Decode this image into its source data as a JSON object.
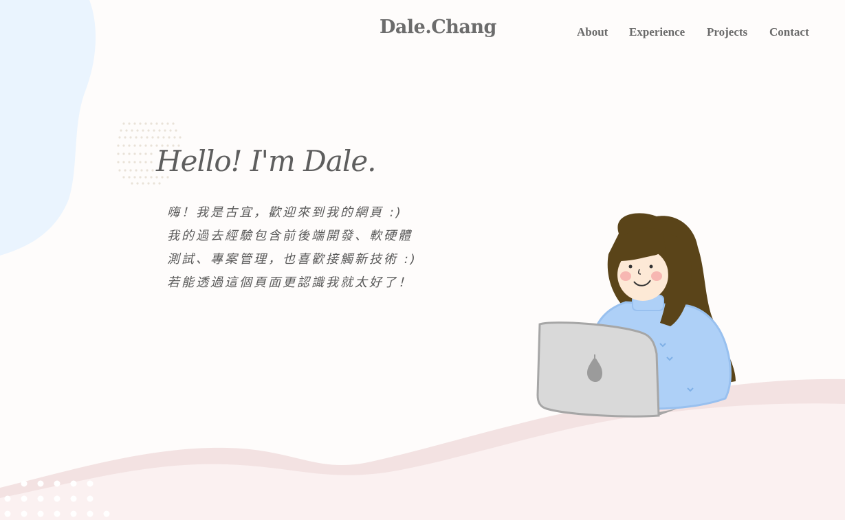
{
  "header": {
    "logo": "Dale.Chang",
    "nav": [
      {
        "label": "About"
      },
      {
        "label": "Experience"
      },
      {
        "label": "Projects"
      },
      {
        "label": "Contact"
      }
    ]
  },
  "hero": {
    "greeting": "Hello! I'm Dale.",
    "intro_lines": [
      "嗨！我是古宜，歡迎來到我的網頁 :)",
      "我的過去經驗包含前後端開發、軟硬體",
      "測試、專案管理，也喜歡接觸新技術 :)",
      "若能透過這個頁面更認識我就太好了！"
    ]
  },
  "illustration": {
    "icon": "laptop-girl-illustration",
    "colors": {
      "hair": "#5a4419",
      "sweater": "#aed0f7",
      "skin": "#fde9d6",
      "laptop": "#d9d9d9",
      "blob_blue": "#eaf4fe",
      "blob_pink": "#f5e6e6"
    }
  }
}
